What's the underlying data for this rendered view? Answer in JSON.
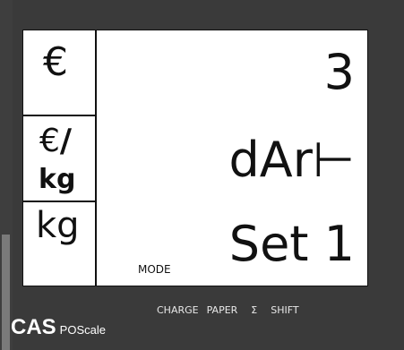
{
  "display": {
    "units": {
      "price": "€",
      "unit_price_top": "€",
      "unit_price_slash": "/",
      "unit_price_bottom": "kg",
      "weight": "kg"
    },
    "rows": {
      "row1": "3",
      "row2": "dAr⊢",
      "row3": "Set 1"
    },
    "mode_label": "MODE"
  },
  "function_keys": [
    "CHARGE",
    "PAPER",
    "Σ",
    "SHIFT"
  ],
  "brand": {
    "name": "CAS",
    "product": "POScale"
  },
  "colors": {
    "body": "#3a3a3a",
    "lcd_background": "#ffffff",
    "lcd_text": "#111111",
    "label_text": "#e8e8e8"
  }
}
